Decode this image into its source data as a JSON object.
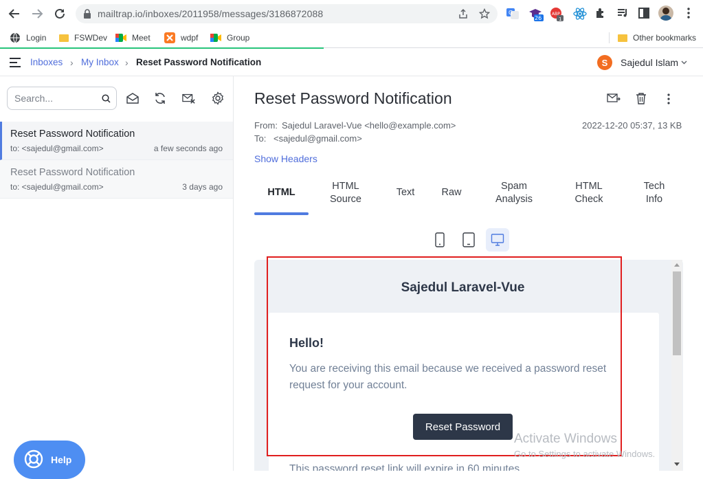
{
  "browser": {
    "url": "mailtrap.io/inboxes/2011958/messages/3186872088",
    "ext_badge_1": "26",
    "ext_badge_2": "1"
  },
  "bookmarks": {
    "items": [
      "Login",
      "FSWDev",
      "Meet",
      "wdpf",
      "Group"
    ],
    "other": "Other bookmarks"
  },
  "header": {
    "breadcrumb": [
      "Inboxes",
      "My Inbox",
      "Reset Password Notification"
    ],
    "user_initial": "S",
    "user_name": "Sajedul Islam"
  },
  "sidebar": {
    "search_placeholder": "Search...",
    "messages": [
      {
        "subject": "Reset Password Notification",
        "to": "to: <sajedul@gmail.com>",
        "time": "a few seconds ago"
      },
      {
        "subject": "Reset Password Notification",
        "to": "to: <sajedul@gmail.com>",
        "time": "3 days ago"
      }
    ],
    "help_label": "Help"
  },
  "message": {
    "title": "Reset Password Notification",
    "from_label": "From:",
    "from_value": "Sajedul Laravel-Vue <hello@example.com>",
    "to_label": "To:",
    "to_value": "<sajedul@gmail.com>",
    "date_size": "2022-12-20 05:37, 13 KB",
    "show_headers": "Show Headers",
    "tabs": [
      {
        "line1": "HTML",
        "line2": ""
      },
      {
        "line1": "HTML",
        "line2": "Source"
      },
      {
        "line1": "Text",
        "line2": ""
      },
      {
        "line1": "Raw",
        "line2": ""
      },
      {
        "line1": "Spam",
        "line2": "Analysis"
      },
      {
        "line1": "HTML",
        "line2": "Check"
      },
      {
        "line1": "Tech",
        "line2": "Info"
      }
    ],
    "active_tab": "HTML"
  },
  "preview": {
    "sender_heading": "Sajedul Laravel-Vue",
    "greeting": "Hello!",
    "body": "You are receiving this email because we received a password reset request for your account.",
    "button_label": "Reset Password",
    "footer_line": "This password reset link will expire in 60 minutes."
  },
  "watermark": {
    "title": "Activate Windows",
    "subtitle": "Go to Settings to activate Windows."
  },
  "colors": {
    "accent": "#4f6ddb",
    "avatar": "#f26d21",
    "help": "#4e8ef2",
    "highlight": "#e01e1e",
    "email_button": "#2d3748"
  }
}
